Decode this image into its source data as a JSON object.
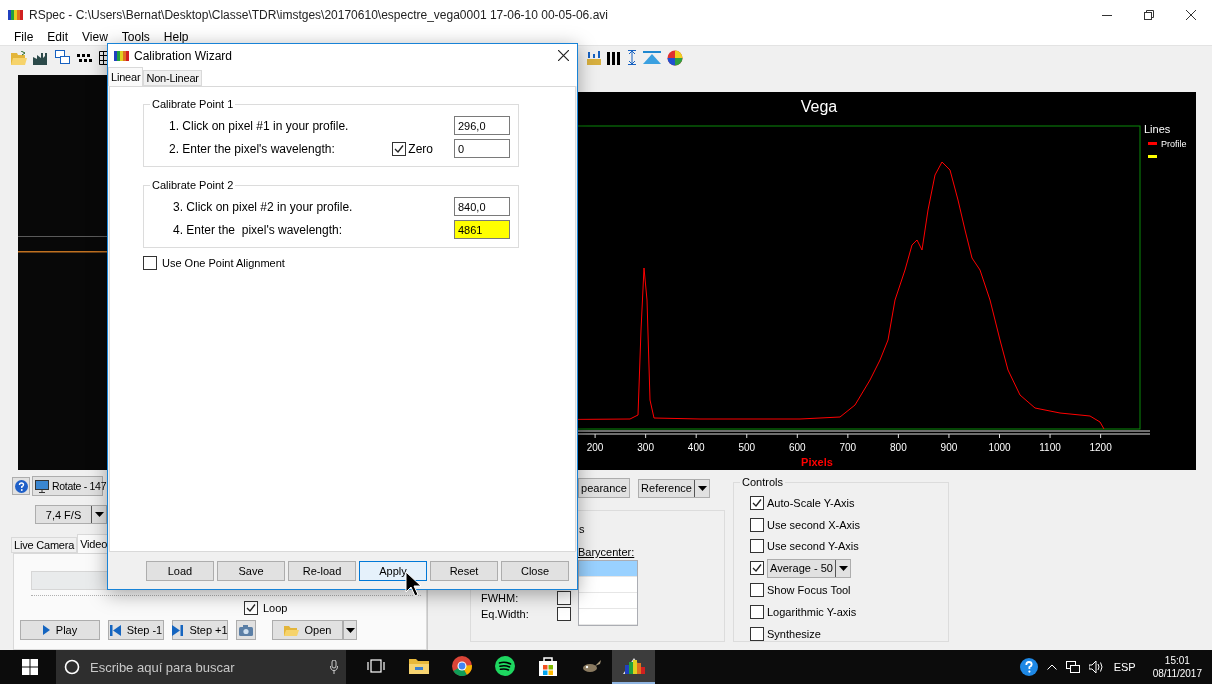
{
  "window": {
    "title": "RSpec - C:\\Users\\Bernat\\Desktop\\Classe\\TDR\\imstges\\20170610\\espectre_vega0001 17-06-10 00-05-06.avi"
  },
  "menu": [
    "File",
    "Edit",
    "View",
    "Tools",
    "Help"
  ],
  "video_panel": {
    "rotate_button": "Rotate - 147",
    "frame_rate": "7,4 F/S",
    "tabs": [
      {
        "label": "Live Camera",
        "selected": false
      },
      {
        "label": "Video",
        "selected": true
      }
    ],
    "loop": {
      "label": "Loop",
      "checked": true
    },
    "buttons": [
      {
        "kind": "play",
        "label": "Play"
      },
      {
        "kind": "step_back",
        "label": "Step -1"
      },
      {
        "kind": "step_forward",
        "label": "Step +1"
      },
      {
        "kind": "camera"
      },
      {
        "kind": "open",
        "label": "Open"
      }
    ]
  },
  "chart": {
    "title": "Vega",
    "xlabel": "Pixels",
    "tick_labels": [
      "200",
      "300",
      "400",
      "500",
      "600",
      "700",
      "800",
      "900",
      "1000",
      "1100",
      "1200"
    ],
    "legend_title": "Lines",
    "legend": [
      {
        "label": "Profile",
        "color": "#ff0000"
      },
      {
        "color": "#ffff00"
      }
    ]
  },
  "profile_tools": {
    "appearance_button": "pearance",
    "reference_button": "Reference",
    "group_label": "s",
    "barycenter_label": "Barycenter:",
    "list_rows": [
      {
        "selected": true
      },
      {
        "selected": false
      },
      {
        "selected": false
      },
      {
        "selected": false
      }
    ],
    "measures": [
      {
        "label": "FWHM:",
        "checked": false
      },
      {
        "label": "Eq.Width:",
        "checked": false
      }
    ]
  },
  "controls": {
    "title": "Controls",
    "items": [
      {
        "kind": "checkbox",
        "label": "Auto-Scale Y-Axis",
        "checked": true
      },
      {
        "kind": "checkbox",
        "label": "Use second X-Axis",
        "checked": false
      },
      {
        "kind": "checkbox",
        "label": "Use second Y-Axis",
        "checked": false
      },
      {
        "kind": "dropdown",
        "value": "Average - 50",
        "checked": true
      },
      {
        "kind": "checkbox",
        "label": "Show Focus Tool",
        "checked": false
      },
      {
        "kind": "checkbox",
        "label": "Logarithmic Y-axis",
        "checked": false
      },
      {
        "kind": "checkbox",
        "label": "Synthesize",
        "checked": false
      }
    ]
  },
  "dialog": {
    "title": "Calibration Wizard",
    "tabs": [
      {
        "label": "Linear",
        "selected": true
      },
      {
        "label": "Non-Linear",
        "selected": false
      }
    ],
    "groups": [
      {
        "title": "Calibrate Point 1",
        "rows": [
          {
            "label": "1. Click on pixel #1 in your profile.",
            "value": "296,0",
            "highlighted": false
          },
          {
            "label": "2. Enter the pixel's wavelength:",
            "value": "0",
            "highlighted": false,
            "zero": {
              "label": "Zero",
              "checked": true
            }
          }
        ]
      },
      {
        "title": "Calibrate Point 2",
        "rows": [
          {
            "label": "3. Click on pixel #2 in your profile.",
            "value": "840,0",
            "highlighted": false
          },
          {
            "label": "4. Enter the  pixel's wavelength:",
            "value": "4861",
            "highlighted": true
          }
        ]
      }
    ],
    "one_point": {
      "label": "Use One Point Alignment",
      "checked": false
    },
    "buttons": [
      {
        "label": "Load",
        "hovered": false
      },
      {
        "label": "Save",
        "hovered": false
      },
      {
        "label": "Re-load",
        "hovered": false
      },
      {
        "label": "Apply",
        "hovered": true
      },
      {
        "label": "Reset",
        "hovered": false
      },
      {
        "label": "Close",
        "hovered": false
      }
    ]
  },
  "taskbar": {
    "search_placeholder": "Escribe aquí para buscar",
    "apps": [
      {
        "kind": "task_view",
        "active": false
      },
      {
        "kind": "folder",
        "active": false
      },
      {
        "kind": "browser",
        "active": false
      },
      {
        "kind": "music",
        "active": false
      },
      {
        "kind": "store",
        "active": false
      },
      {
        "kind": "editor",
        "active": false
      },
      {
        "kind": "spectrum",
        "active": true
      }
    ],
    "language": "ESP",
    "time": "15:01",
    "date": "08/11/2017"
  }
}
